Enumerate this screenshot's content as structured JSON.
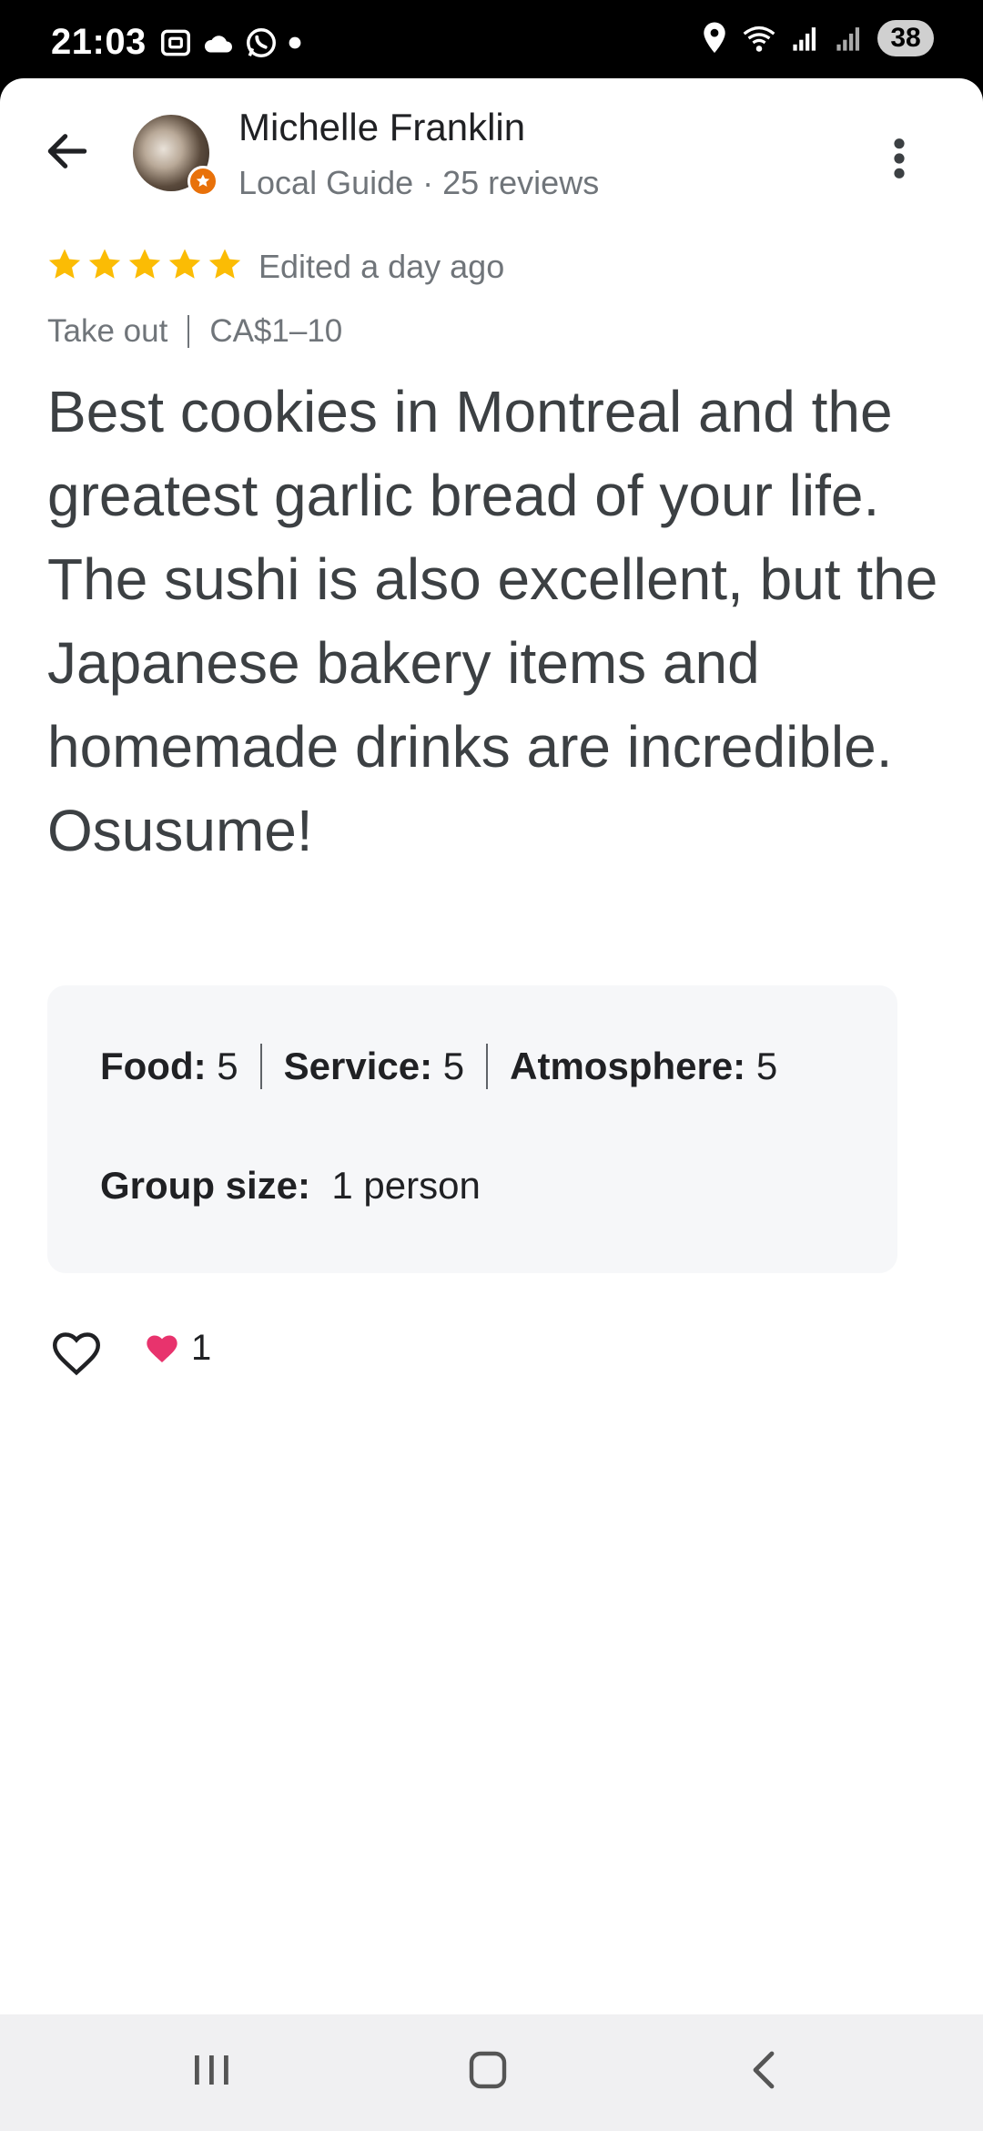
{
  "status_bar": {
    "time": "21:03",
    "battery": "38",
    "left_icons": [
      "screenshot-icon",
      "cloud-icon",
      "whatsapp-icon",
      "dot-icon"
    ],
    "right_icons": [
      "location-icon",
      "wifi-icon",
      "signal-icon",
      "signal-icon-2"
    ]
  },
  "header": {
    "user_name": "Michelle Franklin",
    "user_meta": "Local Guide · 25 reviews"
  },
  "review": {
    "rating": 5,
    "edited": "Edited a day ago",
    "tag_service": "Take out",
    "tag_price": "CA$1–10",
    "text": "Best cookies in Montreal and the greatest garlic bread of your life.\nThe sushi is also excellent, but the Japanese bakery items and homemade drinks are incredible. Osusume!"
  },
  "ratings": {
    "food_label": "Food:",
    "food_value": "5",
    "service_label": "Service:",
    "service_value": "5",
    "atmosphere_label": "Atmosphere:",
    "atmosphere_value": "5",
    "group_label": "Group size:",
    "group_value": "1 person"
  },
  "reactions": {
    "like_count": "1"
  },
  "colors": {
    "star": "#fbbc04",
    "guide_badge": "#e8710a",
    "heart_fill": "#e8336d"
  }
}
